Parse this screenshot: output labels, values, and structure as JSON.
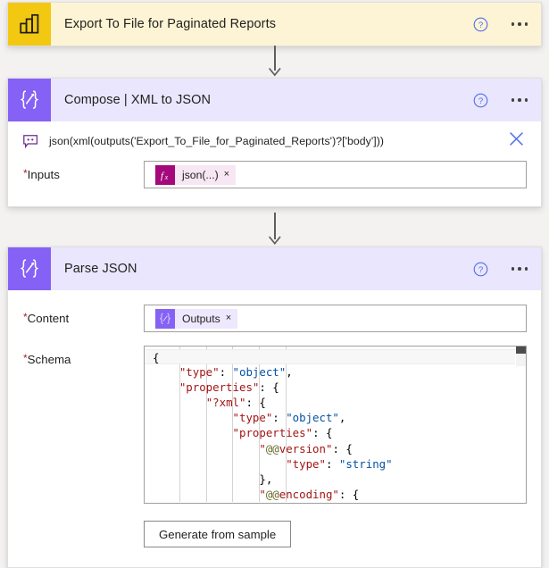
{
  "theme": {
    "canvas_bg": "#f3f2f1",
    "powerbi_yellow": "#f2c811",
    "powerbi_header_bg": "#fcf4d4",
    "compose_purple": "#8661f5",
    "compose_header_bg": "#eae6fd",
    "expression_magenta": "#a4087a",
    "required_red": "#a4262c",
    "help_blue": "#4f6bed"
  },
  "steps": [
    {
      "id": "export-to-file",
      "title": "Export To File for Paginated Reports",
      "icon": "powerbi-bar-chart-icon",
      "help_label": "?",
      "menu_label": "…"
    },
    {
      "id": "compose-xml-to-json",
      "title": "Compose | XML to JSON",
      "icon": "compose-braces-pencil-icon",
      "help_label": "?",
      "menu_label": "…",
      "expression": {
        "icon": "expression-tooltip-icon",
        "text": "json(xml(outputs('Export_To_File_for_Paginated_Reports')?['body']))",
        "dismiss_label": "×"
      },
      "fields": [
        {
          "label": "Inputs",
          "required": true,
          "token": {
            "badge": "fx",
            "badge_icon": "function-fx-icon",
            "label": "json(...)",
            "remove_label": "×"
          }
        }
      ]
    },
    {
      "id": "parse-json",
      "title": "Parse JSON",
      "icon": "compose-braces-pencil-icon",
      "help_label": "?",
      "menu_label": "…",
      "fields": [
        {
          "label": "Content",
          "required": true,
          "token": {
            "badge": "compose",
            "badge_icon": "compose-braces-pencil-icon",
            "label": "Outputs",
            "remove_label": "×"
          }
        },
        {
          "label": "Schema",
          "required": true
        }
      ],
      "generate_button_label": "Generate from sample"
    }
  ],
  "schema_editor": {
    "lines": [
      {
        "indent": 0,
        "active": true,
        "tokens": [
          {
            "t": "{",
            "c": "p"
          }
        ]
      },
      {
        "indent": 1,
        "active": false,
        "tokens": [
          {
            "t": "\"type\"",
            "c": "k"
          },
          {
            "t": ": ",
            "c": "p"
          },
          {
            "t": "\"object\"",
            "c": "s"
          },
          {
            "t": ",",
            "c": "p"
          }
        ]
      },
      {
        "indent": 1,
        "active": false,
        "tokens": [
          {
            "t": "\"properties\"",
            "c": "k"
          },
          {
            "t": ": {",
            "c": "p"
          }
        ]
      },
      {
        "indent": 2,
        "active": false,
        "tokens": [
          {
            "t": "\"?xml\"",
            "c": "k"
          },
          {
            "t": ": {",
            "c": "p"
          }
        ]
      },
      {
        "indent": 3,
        "active": false,
        "tokens": [
          {
            "t": "\"type\"",
            "c": "k"
          },
          {
            "t": ": ",
            "c": "p"
          },
          {
            "t": "\"object\"",
            "c": "s"
          },
          {
            "t": ",",
            "c": "p"
          }
        ]
      },
      {
        "indent": 3,
        "active": false,
        "tokens": [
          {
            "t": "\"properties\"",
            "c": "k"
          },
          {
            "t": ": {",
            "c": "p"
          }
        ]
      },
      {
        "indent": 4,
        "active": false,
        "tokens": [
          {
            "t": "\"",
            "c": "k"
          },
          {
            "t": "@@",
            "c": "at"
          },
          {
            "t": "version\"",
            "c": "k"
          },
          {
            "t": ": {",
            "c": "p"
          }
        ]
      },
      {
        "indent": 5,
        "active": false,
        "tokens": [
          {
            "t": "\"type\"",
            "c": "k"
          },
          {
            "t": ": ",
            "c": "p"
          },
          {
            "t": "\"string\"",
            "c": "s"
          }
        ]
      },
      {
        "indent": 4,
        "active": false,
        "tokens": [
          {
            "t": "},",
            "c": "p"
          }
        ]
      },
      {
        "indent": 4,
        "active": false,
        "tokens": [
          {
            "t": "\"",
            "c": "k"
          },
          {
            "t": "@@",
            "c": "at"
          },
          {
            "t": "encoding\"",
            "c": "k"
          },
          {
            "t": ": {",
            "c": "p"
          }
        ]
      }
    ],
    "scrollbar": {
      "name": "schema-vertical-scrollbar",
      "position": "top"
    }
  }
}
